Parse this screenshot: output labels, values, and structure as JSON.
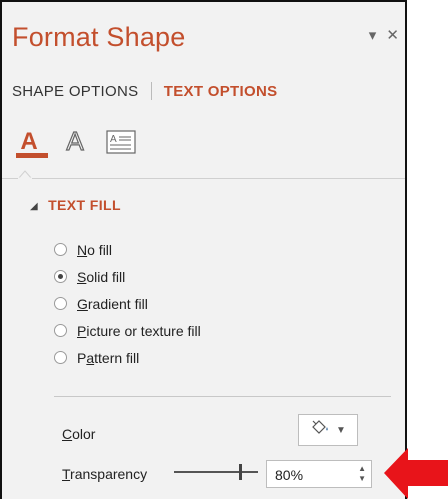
{
  "header": {
    "title": "Format Shape",
    "menu_icon": "dropdown-arrow-icon",
    "close_icon": "close-icon"
  },
  "tabs": [
    {
      "label": "SHAPE OPTIONS",
      "active": false
    },
    {
      "label": "TEXT OPTIONS",
      "active": true
    }
  ],
  "icon_tabs": [
    {
      "name": "text-fill-outline-icon",
      "glyph": "A",
      "active": true
    },
    {
      "name": "text-effects-icon",
      "glyph": "A",
      "active": false
    },
    {
      "name": "textbox-icon",
      "active": false
    }
  ],
  "section": {
    "label": "TEXT FILL",
    "expanded": true
  },
  "fill_options": [
    {
      "pre": "",
      "key": "N",
      "post": "o fill",
      "selected": false
    },
    {
      "pre": "",
      "key": "S",
      "post": "olid fill",
      "selected": true
    },
    {
      "pre": "",
      "key": "G",
      "post": "radient fill",
      "selected": false
    },
    {
      "pre": "",
      "key": "P",
      "post": "icture or texture fill",
      "selected": false
    },
    {
      "pre": "P",
      "key": "a",
      "post": "ttern fill",
      "selected": false
    }
  ],
  "color": {
    "pre": "",
    "key": "C",
    "post": "olor",
    "button_icon": "paint-bucket-icon"
  },
  "transparency": {
    "pre": "",
    "key": "T",
    "post": "ransparency",
    "value": "80%",
    "level": 0.8
  },
  "colors": {
    "accent": "#c34f2d",
    "panel_bg": "#f2f2f2",
    "callout_arrow": "#e8141a"
  }
}
